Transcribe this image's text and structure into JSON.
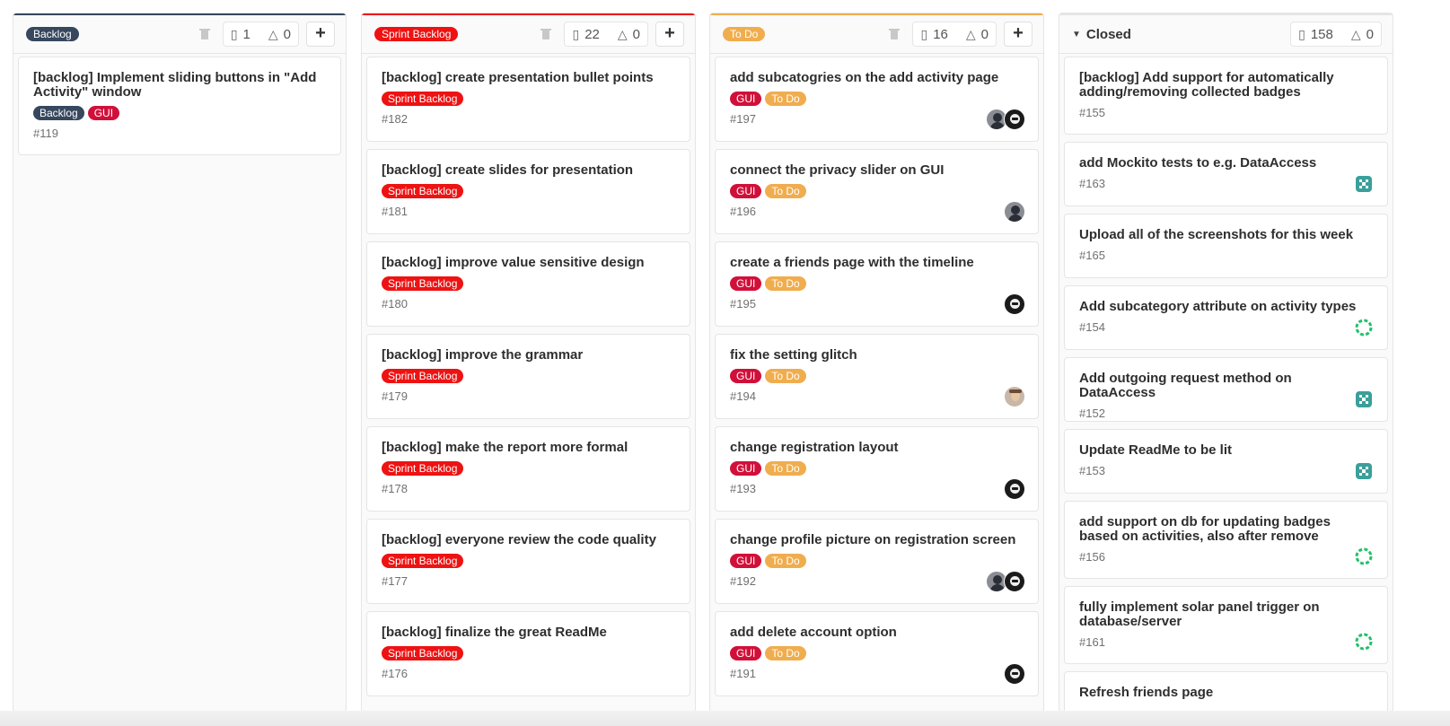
{
  "colors": {
    "backlog": "#36475e",
    "sprint_backlog": "#ee1212",
    "todo": "#f0ad4e",
    "gui": "#d1103a",
    "closed_bar": "#e5e5e5"
  },
  "lists": [
    {
      "name": "Backlog",
      "issues": "1",
      "weight": "0",
      "cards": [
        {
          "title": "[backlog] Implement sliding buttons in \"Add Activity\" window",
          "labels": [
            "Backlog",
            "GUI"
          ],
          "number": "#119",
          "avatars": []
        }
      ]
    },
    {
      "name": "Sprint Backlog",
      "issues": "22",
      "weight": "0",
      "cards": [
        {
          "title": "[backlog] create presentation bullet points",
          "labels": [
            "Sprint Backlog"
          ],
          "number": "#182"
        },
        {
          "title": "[backlog] create slides for presentation",
          "labels": [
            "Sprint Backlog"
          ],
          "number": "#181"
        },
        {
          "title": "[backlog] improve value sensitive design",
          "labels": [
            "Sprint Backlog"
          ],
          "number": "#180"
        },
        {
          "title": "[backlog] improve the grammar",
          "labels": [
            "Sprint Backlog"
          ],
          "number": "#179"
        },
        {
          "title": "[backlog] make the report more formal",
          "labels": [
            "Sprint Backlog"
          ],
          "number": "#178"
        },
        {
          "title": "[backlog] everyone review the code quality",
          "labels": [
            "Sprint Backlog"
          ],
          "number": "#177"
        },
        {
          "title": "[backlog] finalize the great ReadMe",
          "labels": [
            "Sprint Backlog"
          ],
          "number": "#176"
        }
      ]
    },
    {
      "name": "To Do",
      "issues": "16",
      "weight": "0",
      "cards": [
        {
          "title": "add subcatogries on the add activity page",
          "labels": [
            "GUI",
            "To Do"
          ],
          "number": "#197",
          "avatars": [
            "photo-avatar",
            "skull-avatar"
          ]
        },
        {
          "title": "connect the privacy slider on GUI",
          "labels": [
            "GUI",
            "To Do"
          ],
          "number": "#196",
          "avatars": [
            "photo-avatar"
          ]
        },
        {
          "title": "create a friends page with the timeline",
          "labels": [
            "GUI",
            "To Do"
          ],
          "number": "#195",
          "avatars": [
            "skull-avatar"
          ]
        },
        {
          "title": "fix the setting glitch",
          "labels": [
            "GUI",
            "To Do"
          ],
          "number": "#194",
          "avatars": [
            "face-avatar"
          ]
        },
        {
          "title": "change registration layout",
          "labels": [
            "GUI",
            "To Do"
          ],
          "number": "#193",
          "avatars": [
            "skull-avatar"
          ]
        },
        {
          "title": "change profile picture on registration screen",
          "labels": [
            "GUI",
            "To Do"
          ],
          "number": "#192",
          "avatars": [
            "photo-avatar",
            "skull-avatar"
          ]
        },
        {
          "title": "add delete account option",
          "labels": [
            "GUI",
            "To Do"
          ],
          "number": "#191",
          "avatars": [
            "skull-avatar"
          ]
        }
      ]
    },
    {
      "name": "Closed",
      "issues": "158",
      "weight": "0",
      "cards": [
        {
          "title": "[backlog] Add support for automatically adding/removing collected badges",
          "number": "#155",
          "avatars": []
        },
        {
          "title": "add Mockito tests to e.g. DataAccess",
          "number": "#163",
          "avatars": [
            "pixel-avatar"
          ]
        },
        {
          "title": "Upload all of the screenshots for this week",
          "number": "#165",
          "avatars": []
        },
        {
          "title": "Add subcategory attribute on activity types",
          "number": "#154",
          "avatars": [
            "ring-avatar"
          ]
        },
        {
          "title": "Add outgoing request method on DataAccess",
          "number": "#152",
          "avatars": [
            "pixel-avatar"
          ]
        },
        {
          "title": "Update ReadMe to be lit",
          "number": "#153",
          "avatars": [
            "pixel-avatar"
          ]
        },
        {
          "title": "add support on db for updating badges based on activities, also after remove",
          "number": "#156",
          "avatars": [
            "ring-avatar"
          ]
        },
        {
          "title": "fully implement solar panel trigger on database/server",
          "number": "#161",
          "avatars": [
            "ring-avatar"
          ]
        },
        {
          "title": "Refresh friends page",
          "number": "",
          "avatars": []
        }
      ]
    }
  ]
}
